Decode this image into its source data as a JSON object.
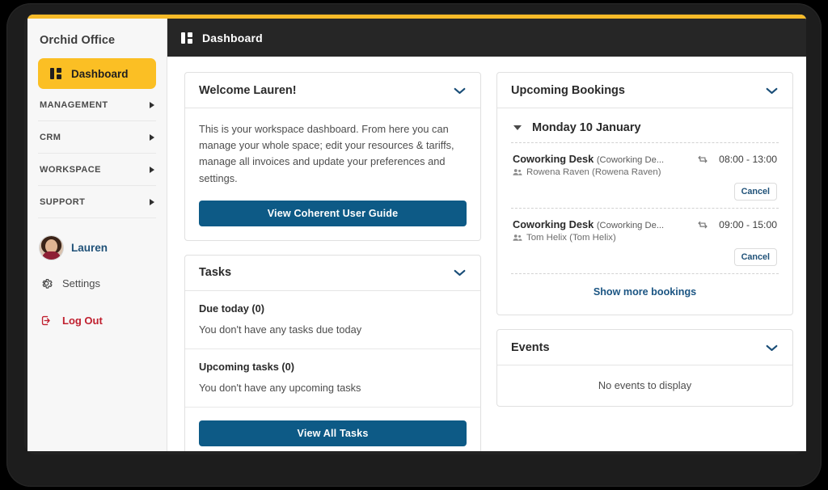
{
  "brand": {
    "title": "Orchid Office"
  },
  "sidebar": {
    "primary_nav": {
      "label": "Dashboard",
      "icon": "dashboard-icon"
    },
    "sections": [
      {
        "label": "MANAGEMENT",
        "icon": "caret-right-icon"
      },
      {
        "label": "CRM",
        "icon": "caret-right-icon"
      },
      {
        "label": "WORKSPACE",
        "icon": "caret-right-icon"
      },
      {
        "label": "SUPPORT",
        "icon": "caret-right-icon"
      }
    ],
    "user": {
      "name": "Lauren",
      "avatar": "user-avatar-photo"
    },
    "utilities": [
      {
        "label": "Settings",
        "icon": "gear-icon"
      },
      {
        "label": "Log Out",
        "icon": "logout-icon"
      }
    ]
  },
  "header": {
    "title": "Dashboard",
    "icon": "dashboard-icon"
  },
  "welcome_card": {
    "title": "Welcome Lauren!",
    "collapse_icon": "chevron-down-icon",
    "body": "This is your workspace dashboard. From here you can manage your whole space; edit your resources & tariffs, manage all invoices and update your preferences and settings.",
    "cta_label": "View Coherent User Guide"
  },
  "tasks_card": {
    "title": "Tasks",
    "collapse_icon": "chevron-down-icon",
    "groups": [
      {
        "title": "Due today (0)",
        "empty_text": "You don't have any tasks due today"
      },
      {
        "title": "Upcoming tasks (0)",
        "empty_text": "You don't have any upcoming tasks"
      }
    ],
    "cta_label": "View All Tasks"
  },
  "bookings_card": {
    "title": "Upcoming Bookings",
    "collapse_icon": "chevron-down-icon",
    "day_group": {
      "label": "Monday 10 January",
      "toggle_icon": "caret-down-icon"
    },
    "items": [
      {
        "resource": "Coworking Desk",
        "resource_detail": "(Coworking De...",
        "person": "Rowena Raven (Rowena Raven)",
        "person_icon": "people-icon",
        "recurring_icon": "repeat-icon",
        "time": "08:00 - 13:00",
        "cancel_label": "Cancel"
      },
      {
        "resource": "Coworking Desk",
        "resource_detail": "(Coworking De...",
        "person": "Tom Helix (Tom Helix)",
        "person_icon": "people-icon",
        "recurring_icon": "repeat-icon",
        "time": "09:00 - 15:00",
        "cancel_label": "Cancel"
      }
    ],
    "show_more_label": "Show more bookings"
  },
  "events_card": {
    "title": "Events",
    "collapse_icon": "chevron-down-icon",
    "empty_text": "No events to display"
  },
  "colors": {
    "accent_yellow": "#f6ba28",
    "nav_active": "#fbbf24",
    "primary_blue": "#0d5a86",
    "link_blue": "#1b5583",
    "logout_red": "#c0202f",
    "header_dark": "#262626"
  }
}
